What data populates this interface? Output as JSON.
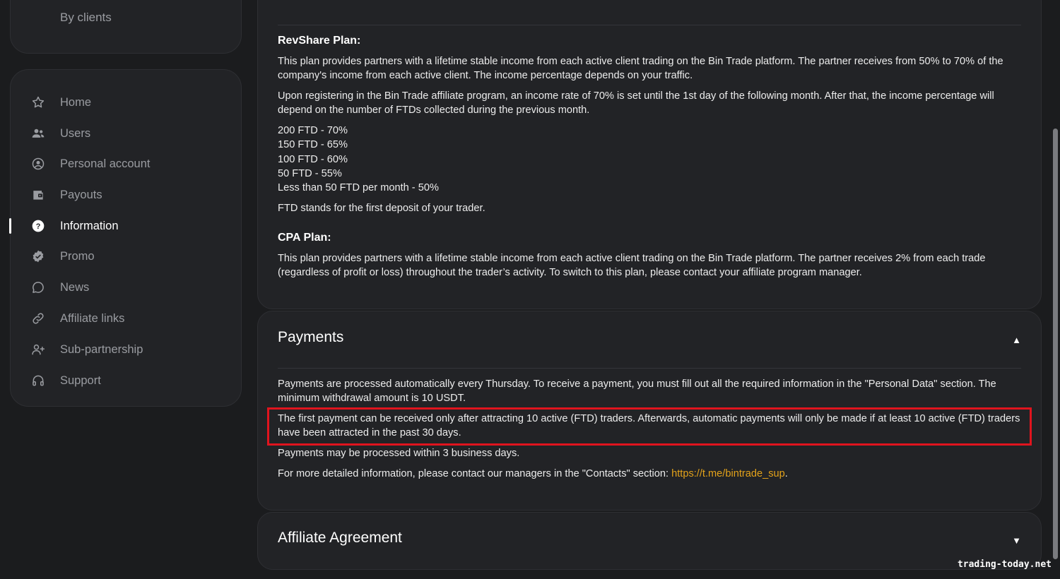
{
  "sidebar": {
    "top_label": "By clients",
    "items": [
      {
        "label": "Home"
      },
      {
        "label": "Users"
      },
      {
        "label": "Personal account"
      },
      {
        "label": "Payouts"
      },
      {
        "label": "Information"
      },
      {
        "label": "Promo"
      },
      {
        "label": "News"
      },
      {
        "label": "Affiliate links"
      },
      {
        "label": "Sub-partnership"
      },
      {
        "label": "Support"
      }
    ],
    "active_item": "Information"
  },
  "plans": {
    "revshare_title": "RevShare Plan:",
    "revshare_p1": "This plan provides partners with a lifetime stable income from each active client trading on the Bin Trade platform. The partner receives from 50% to 70% of the company's income from each active client. The income percentage depends on your traffic.",
    "revshare_p2": "Upon registering in the Bin Trade affiliate program, an income rate of 70% is set until the 1st day of the following month. After that, the income percentage will depend on the number of FTDs collected during the previous month.",
    "tiers": [
      "200 FTD - 70%",
      "150 FTD - 65%",
      "100 FTD - 60%",
      "50 FTD - 55%",
      "Less than 50 FTD per month - 50%"
    ],
    "ftd_note": "FTD stands for the first deposit of your trader.",
    "cpa_title": "CPA Plan:",
    "cpa_p1": "This plan provides partners with a lifetime stable income from each active client trading on the Bin Trade platform. The partner receives 2% from each trade (regardless of profit or loss) throughout the trader’s activity. To switch to this plan, please contact your affiliate program manager."
  },
  "payments": {
    "title": "Payments",
    "chevron": "▲",
    "p1": "Payments are processed automatically every Thursday. To receive a payment, you must fill out all the required information in the \"Personal Data\" section. The minimum withdrawal amount is 10 USDT.",
    "p2": "The first payment can be received only after attracting 10 active (FTD) traders. Afterwards, automatic payments will only be made if at least 10 active (FTD) traders have been attracted in the past 30 days.",
    "p3": "Payments may be processed within 3 business days.",
    "p4_text": "For more detailed information, please contact our managers in the \"Contacts\" section: ",
    "p4_link": "https://t.me/bintrade_sup",
    "p4_end": "."
  },
  "agreement": {
    "title": "Affiliate Agreement",
    "chevron": "▼"
  },
  "watermark": "trading-today.net",
  "colors": {
    "background": "#1b1c1e",
    "card": "#222326",
    "link": "#e3a21a",
    "highlight": "#e0141e"
  }
}
